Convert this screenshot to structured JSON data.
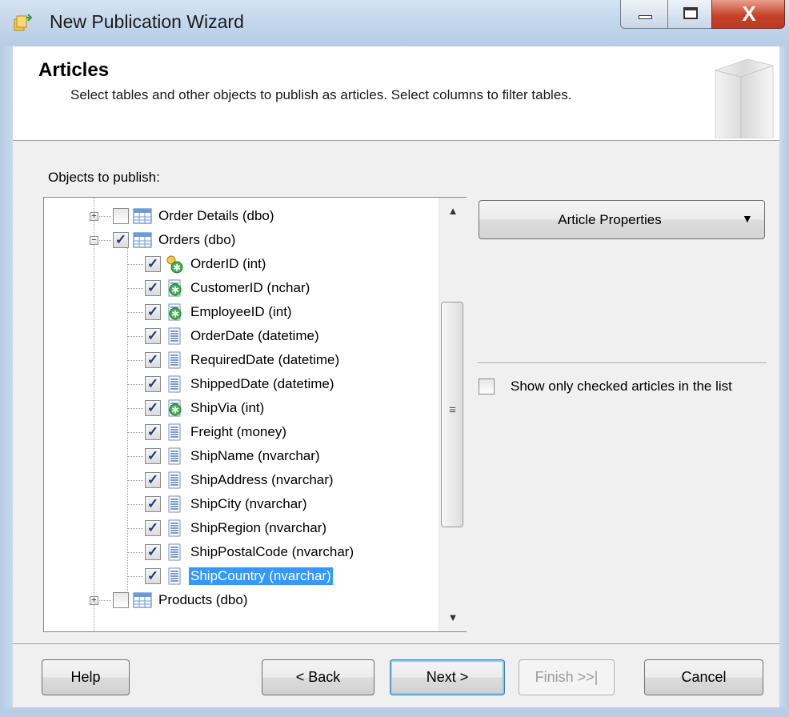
{
  "window": {
    "title": "New Publication Wizard",
    "close_glyph": "X"
  },
  "header": {
    "title": "Articles",
    "description": "Select tables and other objects to publish as articles. Select columns to filter tables."
  },
  "tree": {
    "label": "Objects to publish:",
    "items": [
      {
        "label": "Order Details (dbo)",
        "checked": false,
        "icon": "table-icon",
        "expander": "+"
      },
      {
        "label": "Orders (dbo)",
        "checked": true,
        "icon": "table-icon",
        "expander": "−"
      },
      {
        "label": "OrderID (int)",
        "checked": true,
        "icon": "primary-key-column-icon"
      },
      {
        "label": "CustomerID (nchar)",
        "checked": true,
        "icon": "foreign-key-column-icon"
      },
      {
        "label": "EmployeeID (int)",
        "checked": true,
        "icon": "foreign-key-column-icon"
      },
      {
        "label": "OrderDate (datetime)",
        "checked": true,
        "icon": "column-icon"
      },
      {
        "label": "RequiredDate (datetime)",
        "checked": true,
        "icon": "column-icon"
      },
      {
        "label": "ShippedDate (datetime)",
        "checked": true,
        "icon": "column-icon"
      },
      {
        "label": "ShipVia (int)",
        "checked": true,
        "icon": "foreign-key-column-icon"
      },
      {
        "label": "Freight (money)",
        "checked": true,
        "icon": "column-icon"
      },
      {
        "label": "ShipName (nvarchar)",
        "checked": true,
        "icon": "column-icon"
      },
      {
        "label": "ShipAddress (nvarchar)",
        "checked": true,
        "icon": "column-icon"
      },
      {
        "label": "ShipCity (nvarchar)",
        "checked": true,
        "icon": "column-icon"
      },
      {
        "label": "ShipRegion (nvarchar)",
        "checked": true,
        "icon": "column-icon"
      },
      {
        "label": "ShipPostalCode (nvarchar)",
        "checked": true,
        "icon": "column-icon"
      },
      {
        "label": "ShipCountry (nvarchar)",
        "checked": true,
        "icon": "column-icon",
        "selected": true
      },
      {
        "label": "Products (dbo)",
        "checked": false,
        "icon": "table-icon",
        "expander": "+"
      }
    ]
  },
  "right_panel": {
    "article_properties_label": "Article Properties",
    "show_checked_label": "Show only checked articles in the list",
    "show_checked": false
  },
  "buttons": {
    "help": "Help",
    "back": "< Back",
    "next": "Next >",
    "finish": "Finish >>|",
    "cancel": "Cancel"
  }
}
